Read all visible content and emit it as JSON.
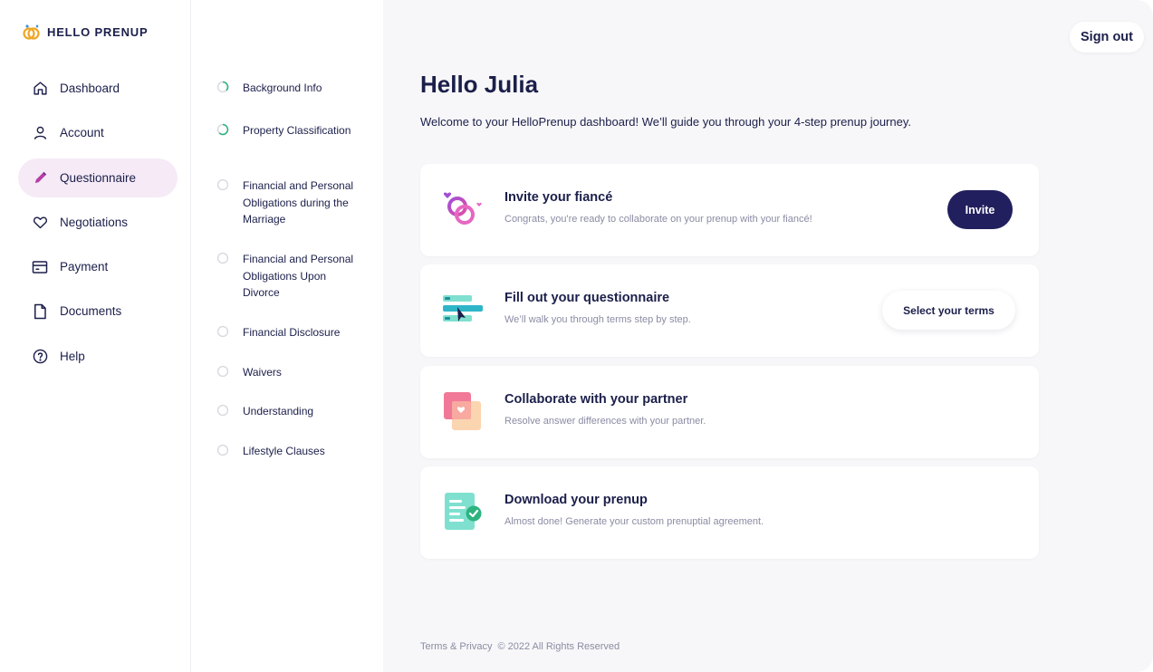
{
  "brand": {
    "name": "HELLO PRENUP"
  },
  "sidebar": {
    "items": [
      {
        "label": "Dashboard",
        "icon": "home-icon"
      },
      {
        "label": "Account",
        "icon": "user-icon"
      },
      {
        "label": "Questionnaire",
        "icon": "pencil-icon",
        "active": true
      },
      {
        "label": "Negotiations",
        "icon": "heart-icon"
      },
      {
        "label": "Payment",
        "icon": "credit-card-icon"
      },
      {
        "label": "Documents",
        "icon": "document-icon"
      },
      {
        "label": "Help",
        "icon": "help-circle-icon"
      }
    ]
  },
  "steps": [
    {
      "label": "Background Info",
      "status": "in-progress"
    },
    {
      "label": "Property Classification",
      "status": "in-progress"
    },
    {
      "label": "Financial and Personal Obligations during the Marriage",
      "status": "not-started"
    },
    {
      "label": "Financial and Personal Obligations Upon Divorce",
      "status": "not-started"
    },
    {
      "label": "Financial Disclosure",
      "status": "not-started"
    },
    {
      "label": "Waivers",
      "status": "not-started"
    },
    {
      "label": "Understanding",
      "status": "not-started"
    },
    {
      "label": "Lifestyle Clauses",
      "status": "not-started"
    }
  ],
  "header": {
    "sign_out": "Sign out"
  },
  "main": {
    "greeting": "Hello Julia",
    "welcome": "Welcome to your HelloPrenup dashboard! We’ll guide you through your 4-step prenup journey.",
    "cards": [
      {
        "title": "Invite your fiancé",
        "subtitle": "Congrats, you're ready to collaborate on your prenup with your fiancé!",
        "button": "Invite",
        "icon": "rings-icon"
      },
      {
        "title": "Fill out your questionnaire",
        "subtitle": "We’ll walk you through terms step by step.",
        "button": "Select your terms",
        "icon": "form-cursor-icon"
      },
      {
        "title": "Collaborate with your partner",
        "subtitle": "Resolve answer differences with your partner.",
        "icon": "heart-card-icon"
      },
      {
        "title": "Download your prenup",
        "subtitle": "Almost done! Generate your custom prenuptial agreement.",
        "icon": "document-check-icon"
      }
    ]
  },
  "footer": {
    "terms": "Terms & Privacy",
    "copyright": "© 2022 All Rights Reserved"
  },
  "colors": {
    "accent": "#221f5e",
    "active_bg": "#f5eaf6",
    "progress": "#2eb37f",
    "bg": "#f7f7f9"
  }
}
